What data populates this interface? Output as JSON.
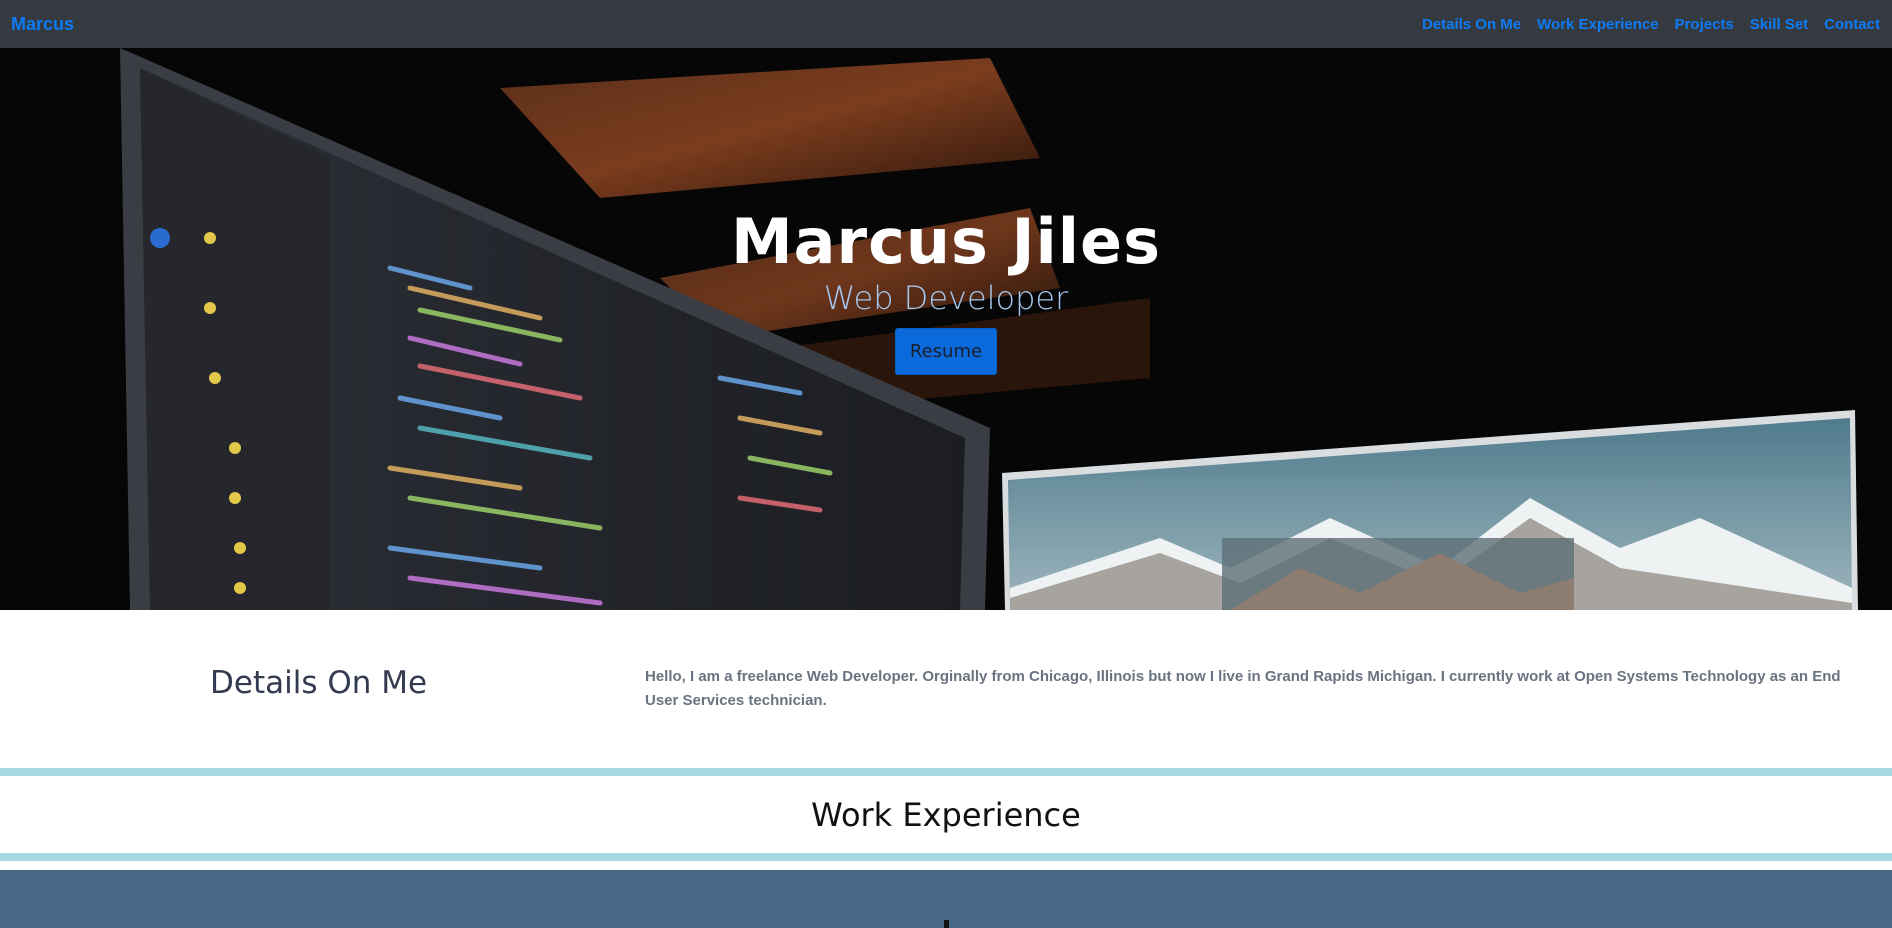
{
  "navbar": {
    "brand": "Marcus",
    "links": [
      "Details On Me",
      "Work Experience",
      "Projects",
      "Skill Set",
      "Contact"
    ]
  },
  "hero": {
    "title": "Marcus Jiles",
    "subtitle": "Web Developer",
    "button_label": "Resume"
  },
  "details": {
    "title": "Details On Me",
    "text": "Hello, I am a freelance Web Developer. Orginally from Chicago, Illinois but now I live in Grand Rapids Michigan. I currently work at Open Systems Technology as an End User Services technician."
  },
  "work": {
    "title": "Work Experience"
  },
  "colors": {
    "navbar_bg": "#343a40",
    "link": "#0d7bf6",
    "accent_stripe": "#a8d8e4",
    "band": "#476889",
    "button": "#0a6adc"
  }
}
